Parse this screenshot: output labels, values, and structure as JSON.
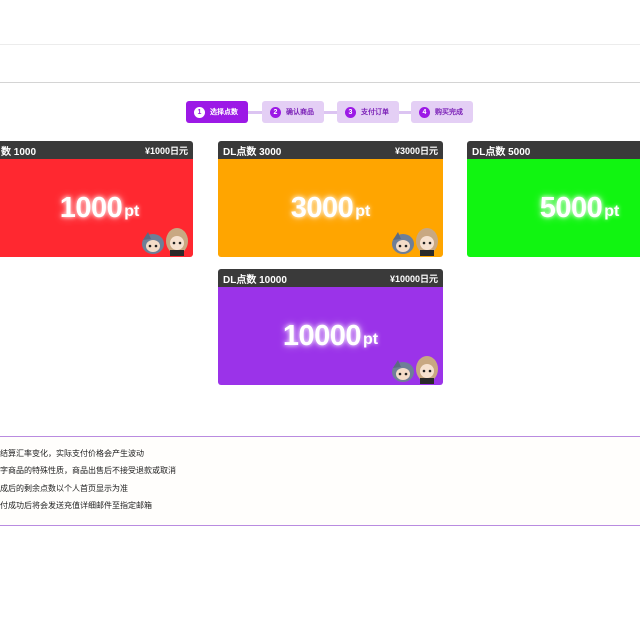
{
  "steps": [
    {
      "num": "1",
      "label": "选择点数"
    },
    {
      "num": "2",
      "label": "确认商品"
    },
    {
      "num": "3",
      "label": "支付订单"
    },
    {
      "num": "4",
      "label": "购买完成"
    }
  ],
  "cards": [
    {
      "title": "数 1000",
      "price": "¥1000日元",
      "amount": "1000",
      "unit": "pt",
      "color": "#ff2830"
    },
    {
      "title": "DL点数 3000",
      "price": "¥3000日元",
      "amount": "3000",
      "unit": "pt",
      "color": "#ffa500"
    },
    {
      "title": "DL点数 5000",
      "price": "",
      "amount": "5000",
      "unit": "pt",
      "color": "#11f511"
    },
    {
      "title": "DL点数 10000",
      "price": "¥10000日元",
      "amount": "10000",
      "unit": "pt",
      "color": "#9b33e9"
    }
  ],
  "notes": [
    "结算汇率变化，实际支付价格会产生波动",
    "字商品的特殊性质，商品出售后不接受退款或取消",
    "成后的剩余点数以个人首页显示为准",
    "付成功后将会发送充值详细邮件至指定邮箱"
  ]
}
